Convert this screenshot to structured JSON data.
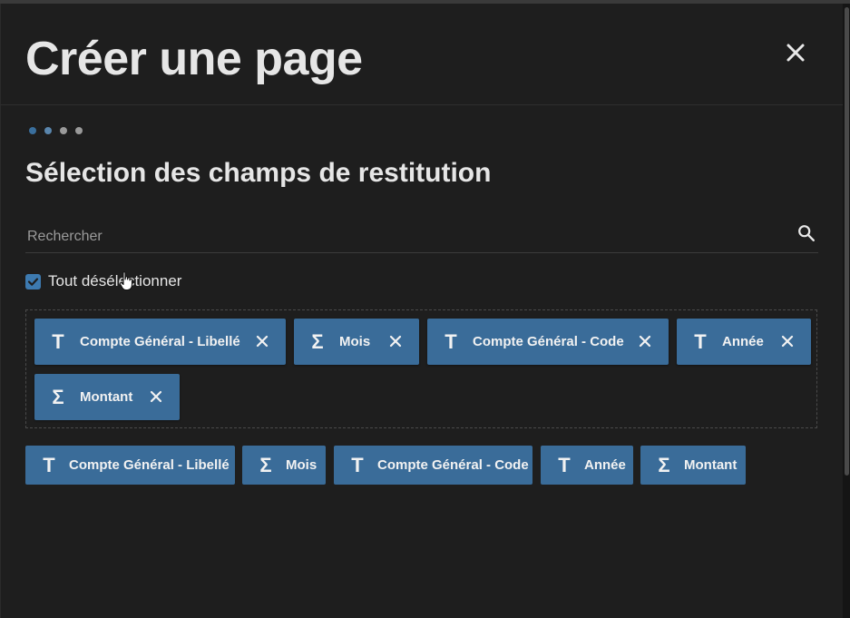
{
  "dialog": {
    "title": "Créer une page",
    "close_icon": "close-icon"
  },
  "stepper": {
    "total_steps": 4,
    "current_step": 2
  },
  "section": {
    "title": "Sélection des champs de restitution"
  },
  "search": {
    "placeholder": "Rechercher",
    "value": "",
    "icon": "search-icon"
  },
  "select_all": {
    "label": "Tout désélectionner",
    "checked": true
  },
  "selected_fields": [
    {
      "type_icon": "T",
      "label": "Compte Général - Libellé"
    },
    {
      "type_icon": "Σ",
      "label": "Mois"
    },
    {
      "type_icon": "T",
      "label": "Compte Général - Code"
    },
    {
      "type_icon": "T",
      "label": "Année"
    },
    {
      "type_icon": "Σ",
      "label": "Montant"
    }
  ],
  "available_fields": [
    {
      "type_icon": "T",
      "label": "Compte Général - Libellé"
    },
    {
      "type_icon": "Σ",
      "label": "Mois"
    },
    {
      "type_icon": "T",
      "label": "Compte Général - Code"
    },
    {
      "type_icon": "T",
      "label": "Année"
    },
    {
      "type_icon": "Σ",
      "label": "Montant"
    }
  ],
  "colors": {
    "accent": "#3a6c99",
    "background": "#1e1e1e",
    "text": "#e6e6e6"
  }
}
